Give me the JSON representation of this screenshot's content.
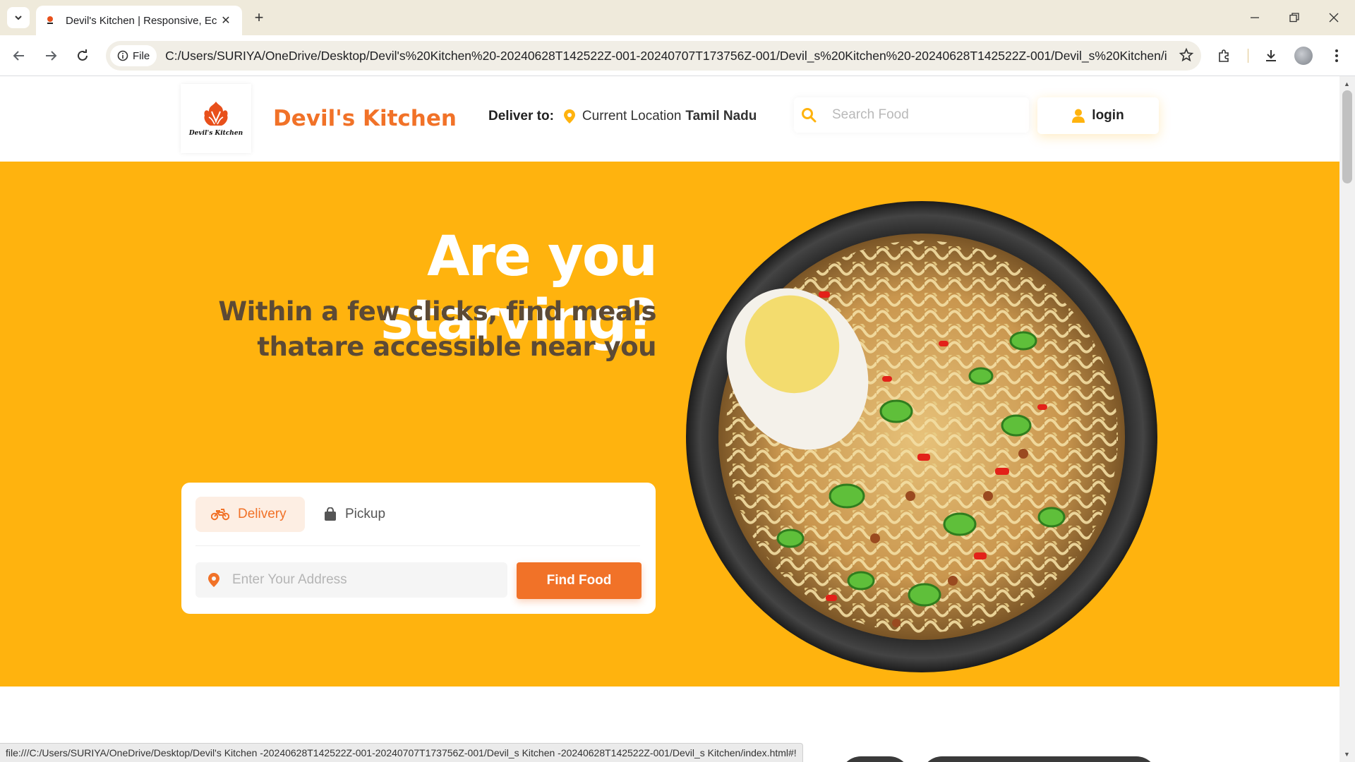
{
  "browser": {
    "tab_title": "Devil's Kitchen | Responsive, Ec",
    "site_chip": "File",
    "url": "C:/Users/SURIYA/OneDrive/Desktop/Devil's%20Kitchen%20-20240628T142522Z-001-20240707T173756Z-001/Devil_s%20Kitchen%20-20240628T142522Z-001/Devil_s%20Kitchen/ind...",
    "status_url": "file:///C:/Users/SURIYA/OneDrive/Desktop/Devil's Kitchen -20240628T142522Z-001-20240707T173756Z-001/Devil_s Kitchen -20240628T142522Z-001/Devil_s Kitchen/index.html#!"
  },
  "navbar": {
    "logo_text": "Devil's Kitchen",
    "brand": "Devil's Kitchen",
    "deliver_label": "Deliver to:",
    "location_prefix": "Current Location",
    "location_state": "Tamil Nadu",
    "search_placeholder": "Search Food",
    "login_label": "login"
  },
  "hero": {
    "title": "Are you starving?",
    "subtitle_line1": "Within a few clicks, find meals",
    "subtitle_line2": "thatare accessible near you",
    "tabs": [
      {
        "label": "Delivery",
        "active": true
      },
      {
        "label": "Pickup",
        "active": false
      }
    ],
    "address_placeholder": "Enter Your Address",
    "find_button": "Find Food"
  },
  "colors": {
    "accent": "#f17228",
    "hero_bg": "#ffb30e",
    "subtitle": "#5c4a35"
  }
}
